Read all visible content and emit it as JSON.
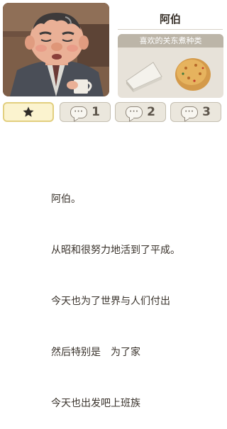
{
  "character": {
    "name": "阿伯"
  },
  "favorites": {
    "header": "喜欢的关东煮种类",
    "items": [
      {
        "name": "tofu-triangle-icon"
      },
      {
        "name": "fried-ganmodoki-icon"
      }
    ]
  },
  "tabs": [
    {
      "icon": "star-icon",
      "label": "",
      "active": true
    },
    {
      "icon": "speech-bubble-icon",
      "label": "1",
      "active": false
    },
    {
      "icon": "speech-bubble-icon",
      "label": "2",
      "active": false
    },
    {
      "icon": "speech-bubble-icon",
      "label": "3",
      "active": false
    }
  ],
  "story": {
    "lines": [
      "阿伯。",
      "从昭和很努力地活到了平成。",
      "今天也为了世界与人们付出",
      "然后特别是　为了家",
      "今天也出发吧上班族"
    ]
  },
  "colors": {
    "active_tab_bg": "#fbf3cf",
    "active_tab_border": "#e2cf7f",
    "inactive_tab_bg": "#ebe7dd",
    "panel_header": "#bcb5a8"
  }
}
